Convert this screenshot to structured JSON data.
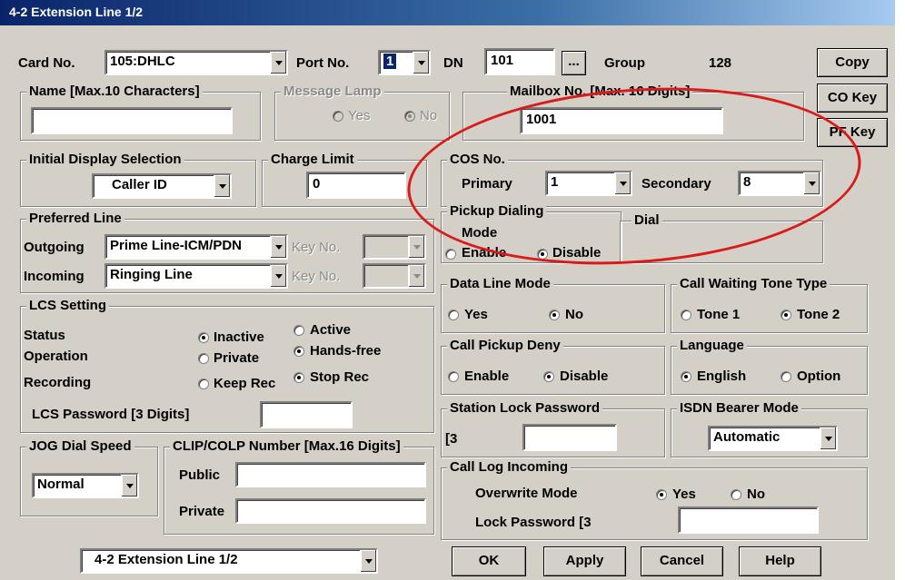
{
  "window": {
    "title": "4-2 Extension Line 1/2"
  },
  "top": {
    "card_label": "Card No.",
    "card_value": "105:DHLC",
    "port_label": "Port No.",
    "port_value": "1",
    "dn_label": "DN",
    "dn_value": "101",
    "dn_browse": "...",
    "group_label": "Group",
    "group_value": "128"
  },
  "right_buttons": {
    "copy": "Copy",
    "co_key": "CO Key",
    "pf_key": "PF Key"
  },
  "name": {
    "label": "Name [Max.10 Characters]",
    "value": ""
  },
  "message_lamp": {
    "label": "Message Lamp",
    "yes": "Yes",
    "no": "No",
    "selected": "No"
  },
  "mailbox": {
    "label": "Mailbox No. [Max. 16 Digits]",
    "value": "1001"
  },
  "initial_display": {
    "label": "Initial Display Selection",
    "value": "Caller ID"
  },
  "charge_limit": {
    "label": "Charge Limit",
    "value": "0"
  },
  "cos": {
    "label": "COS No.",
    "primary_label": "Primary",
    "primary_value": "1",
    "secondary_label": "Secondary",
    "secondary_value": "8"
  },
  "preferred_line": {
    "label": "Preferred Line",
    "outgoing_label": "Outgoing",
    "outgoing_value": "Prime Line-ICM/PDN",
    "incoming_label": "Incoming",
    "incoming_value": "Ringing Line",
    "key_no_label": "Key No."
  },
  "pickup_dialing": {
    "label": "Pickup Dialing",
    "mode_label": "Mode",
    "enable": "Enable",
    "disable": "Disable",
    "selected": "Disable",
    "dial_label": "Dial"
  },
  "lcs": {
    "label": "LCS Setting",
    "status_label": "Status",
    "inactive": "Inactive",
    "active": "Active",
    "status_selected": "Inactive",
    "operation_label": "Operation",
    "private": "Private",
    "handsfree": "Hands-free",
    "operation_selected": "Hands-free",
    "recording_label": "Recording",
    "keep_rec": "Keep Rec",
    "stop_rec": "Stop Rec",
    "recording_selected": "Stop Rec",
    "password_label": "LCS Password [3 Digits]",
    "password_value": ""
  },
  "data_line_mode": {
    "label": "Data Line Mode",
    "yes": "Yes",
    "no": "No",
    "selected": "No"
  },
  "call_waiting": {
    "label": "Call Waiting Tone Type",
    "tone1": "Tone 1",
    "tone2": "Tone 2",
    "selected": "Tone 2"
  },
  "call_pickup_deny": {
    "label": "Call Pickup Deny",
    "enable": "Enable",
    "disable": "Disable",
    "selected": "Disable"
  },
  "language": {
    "label": "Language",
    "english": "English",
    "option": "Option",
    "selected": "English"
  },
  "station_lock": {
    "label": "Station Lock Password",
    "prefix": "[3",
    "value": ""
  },
  "isdn": {
    "label": "ISDN Bearer Mode",
    "value": "Automatic"
  },
  "jog": {
    "label": "JOG Dial Speed",
    "value": "Normal"
  },
  "clip": {
    "label": "CLIP/COLP Number [Max.16 Digits]",
    "public_label": "Public",
    "public_value": "",
    "private_label": "Private",
    "private_value": ""
  },
  "call_log": {
    "label": "Call Log Incoming",
    "overwrite_label": "Overwrite Mode",
    "yes": "Yes",
    "no": "No",
    "selected": "Yes",
    "lock_label": "Lock Password [3",
    "lock_value": ""
  },
  "page_select": {
    "value": "4-2 Extension Line 1/2"
  },
  "bottom_buttons": {
    "ok": "OK",
    "apply": "Apply",
    "cancel": "Cancel",
    "help": "Help"
  },
  "annotation": {
    "ellipse_color": "#d81b1b"
  }
}
